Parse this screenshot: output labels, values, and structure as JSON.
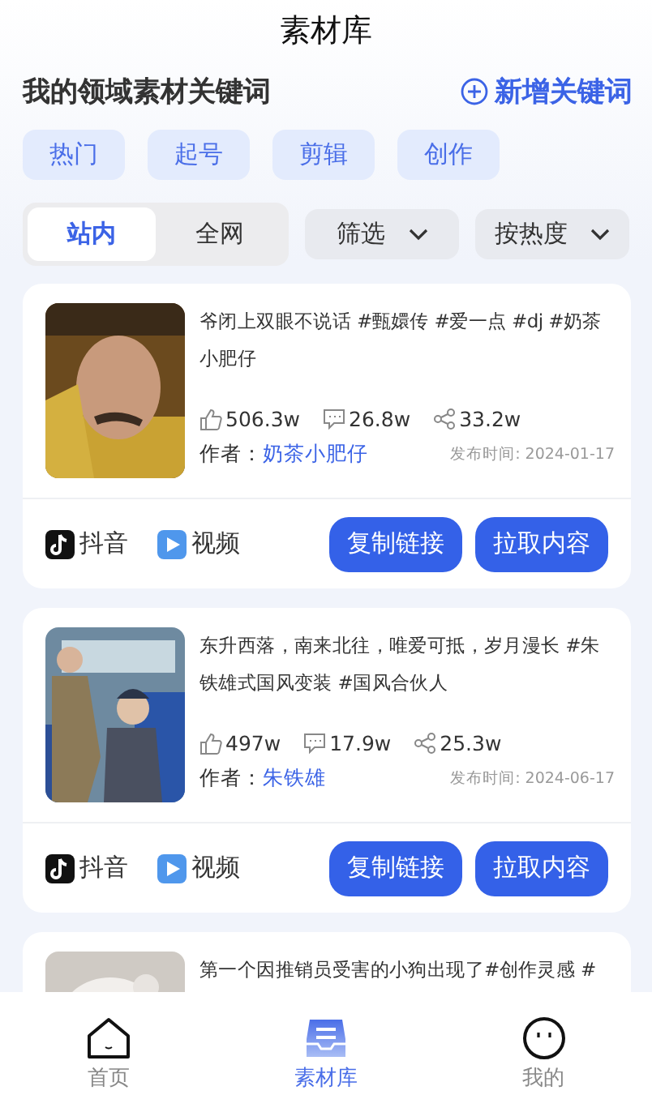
{
  "title": "素材库",
  "section": {
    "heading": "我的领域素材关键词",
    "add_label": "新增关键词"
  },
  "keywords": [
    "热门",
    "起号",
    "剪辑",
    "创作"
  ],
  "scope_tabs": [
    {
      "label": "站内",
      "selected": true
    },
    {
      "label": "全网",
      "selected": false
    }
  ],
  "dropdowns": [
    "筛选",
    "按热度"
  ],
  "cards": [
    {
      "title": "爷闭上双眼不说话 #甄嬛传 #爱一点 #dj #奶茶小肥仔",
      "likes": "506.3w",
      "comments": "26.8w",
      "shares": "33.2w",
      "author_label": "作者：",
      "author": "奶茶小肥仔",
      "date": "发布时间: 2024-01-17",
      "platform": "抖音",
      "type": "视频",
      "actions": [
        "复制链接",
        "拉取内容"
      ],
      "kind": "picture"
    },
    {
      "title": "东升西落，南来北往，唯爱可抵，岁月漫长 #朱铁雄式国风变装 #国风合伙人",
      "likes": "497w",
      "comments": "17.9w",
      "shares": "25.3w",
      "author_label": "作者：",
      "author": "朱铁雄",
      "date": "发布时间: 2024-06-17",
      "platform": "抖音",
      "type": "视频",
      "actions": [
        "复制链接",
        "拉取内容"
      ],
      "kind": "picture"
    },
    {
      "title": "第一个因推销员受害的小狗出现了#创作灵感 #",
      "kind": "picture"
    }
  ],
  "nav": [
    {
      "label": "首页",
      "kind": "home",
      "selected": false
    },
    {
      "label": "素材库",
      "kind": "library",
      "selected": true
    },
    {
      "label": "我的",
      "kind": "me",
      "selected": false
    }
  ]
}
